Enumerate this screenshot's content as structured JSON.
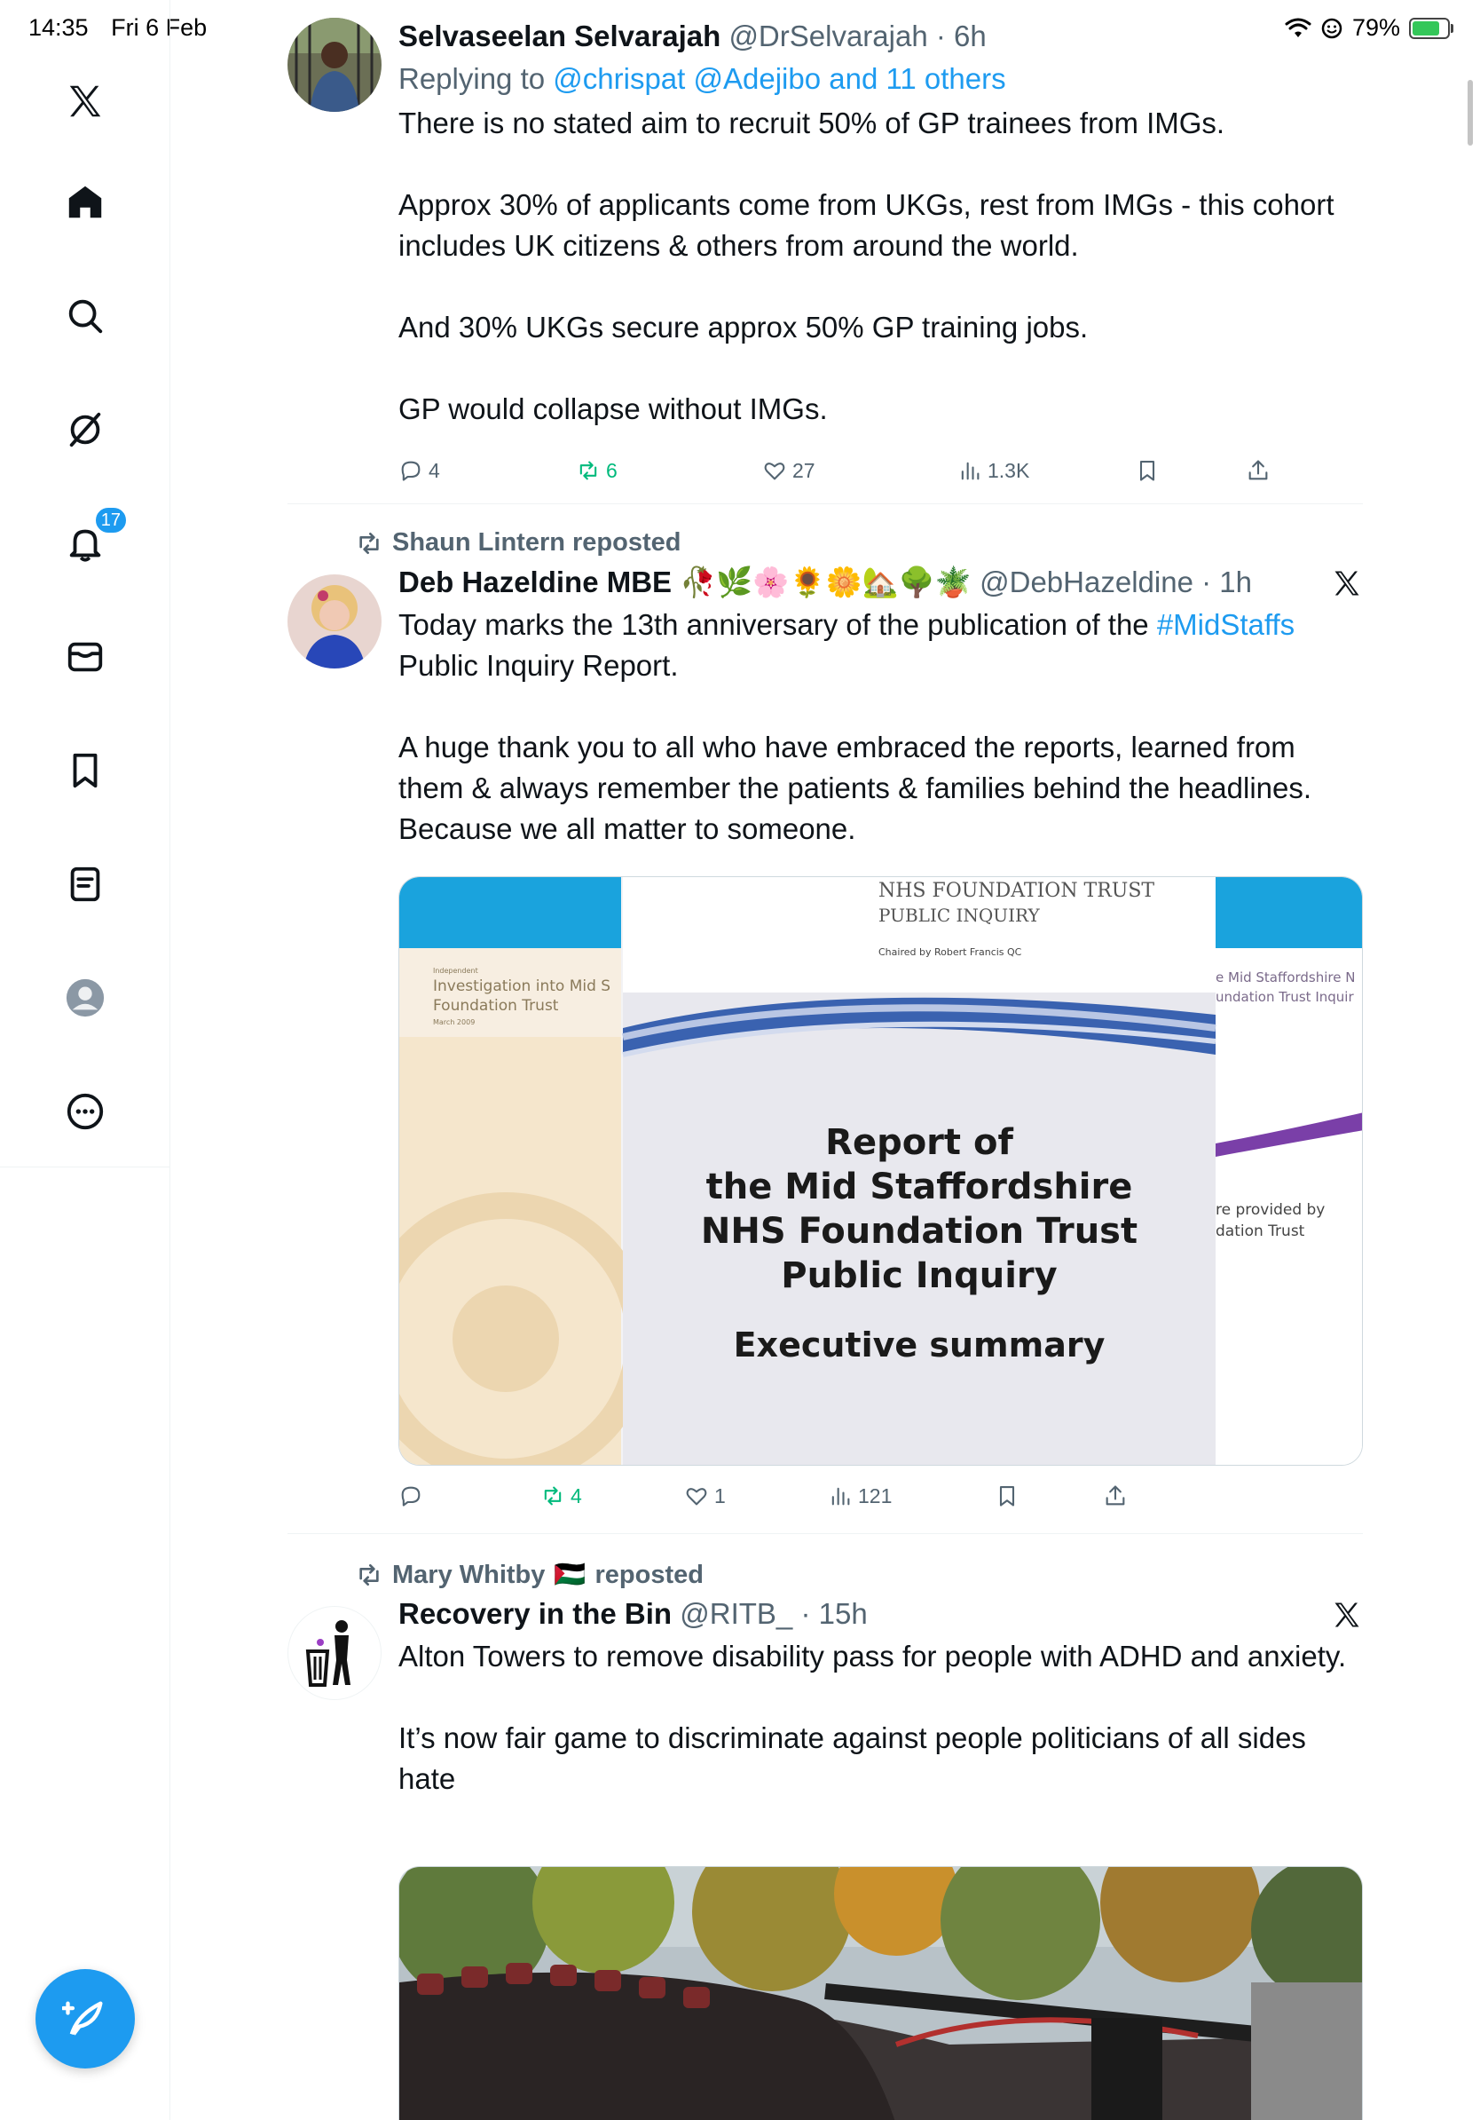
{
  "status_bar": {
    "time": "14:35",
    "date": "Fri 6 Feb",
    "battery": "79%",
    "battery_level": 0.79
  },
  "sidebar": {
    "notifications_badge": "17"
  },
  "tweets": [
    {
      "name": "Selvaseelan Selvarajah",
      "handle": "@DrSelvarajah",
      "time": "6h",
      "reply_prefix": "Replying to ",
      "reply_targets": "@chrispat @Adejibo and 11 others",
      "paragraphs": [
        "There is no stated aim to recruit 50% of GP trainees from IMGs.",
        "Approx 30% of applicants come from UKGs, rest from IMGs - this cohort includes UK citizens & others from around the world.",
        "And 30% UKGs secure approx 50% GP training jobs.",
        "GP would collapse without IMGs."
      ],
      "replies": "4",
      "reposts": "6",
      "likes": "27",
      "views": "1.3K"
    },
    {
      "reposted_by": "Shaun Lintern reposted",
      "name": "Deb Hazeldine MBE",
      "name_emoji": "🥀🌿🌸🌻🌼🏡🌳🪴",
      "handle": "@DebHazeldine",
      "time": "1h",
      "text_before_hashtag": "Today marks the 13th anniversary of the publication of the ",
      "hashtag": "#MidStaffs",
      "text_after_hashtag": " Public Inquiry Report.",
      "paragraph_2": "A huge thank you to all who have embraced the reports, learned from them & always remember the patients & families behind the headlines. Because we all matter to someone.",
      "media": {
        "header_org": "NHS FOUNDATION TRUST",
        "header_sub": "PUBLIC INQUIRY",
        "chaired_by": "Chaired by Robert Francis QC",
        "left_cover_small": "Independent",
        "left_cover_title_1": "Investigation into Mid S",
        "left_cover_title_2": "Foundation Trust",
        "left_cover_date": "March 2009",
        "right_cover_title_1": "e Mid Staffordshire N",
        "right_cover_title_2": "undation Trust Inquir",
        "right_cover_note_1": "re provided by",
        "right_cover_note_2": "dation Trust",
        "title_1": "Report of",
        "title_2": "the Mid Staffordshire",
        "title_3": "NHS Foundation Trust",
        "title_4": "Public Inquiry",
        "subtitle": "Executive summary"
      },
      "reposts": "4",
      "likes": "1",
      "views": "121"
    },
    {
      "reposted_by_name": "Mary Whitby",
      "reposted_by_flag": "🇵🇸",
      "reposted_by_suffix": "reposted",
      "name": "Recovery in the Bin",
      "handle": "@RITB_",
      "time": "15h",
      "paragraph_1": "Alton Towers to remove disability pass for people with ADHD and anxiety.",
      "paragraph_2": "It’s now fair game to discriminate against people politicians of all sides hate"
    }
  ],
  "colors": {
    "accent": "#1d9bf0",
    "repost_green": "#00ba7c",
    "secondary_text": "#536471"
  }
}
